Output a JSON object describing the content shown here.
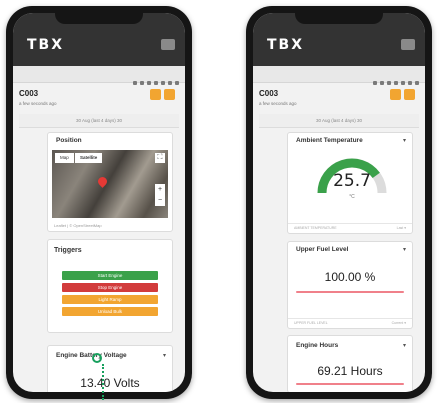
{
  "brand": {
    "logo": "TBX"
  },
  "left": {
    "device": {
      "title": "C003",
      "subtitle": "a few seconds ago"
    },
    "date_range": {
      "label": "30 Aug (last 4 days) 30"
    },
    "position": {
      "title": "Position",
      "map_tabs": [
        "Map",
        "Satellite"
      ],
      "caption": "Leaflet | © OpenStreetMap"
    },
    "triggers": {
      "title": "Triggers",
      "buttons": [
        {
          "label": "Start Engine",
          "color": "#3aa14a"
        },
        {
          "label": "Stop Engine",
          "color": "#d23b3b"
        },
        {
          "label": "Light Ramp",
          "color": "#f2a531"
        },
        {
          "label": "Unload Bulk",
          "color": "#f2a531"
        }
      ]
    },
    "battery": {
      "title": "Engine Battery Voltage",
      "value": "13.40 Volts"
    }
  },
  "right": {
    "device": {
      "title": "C003",
      "subtitle": "a few seconds ago"
    },
    "date_range": {
      "label": "30 Aug (last 4 days) 30"
    },
    "ambient": {
      "title": "Ambient Temperature",
      "value": "25.7",
      "unit": "°C",
      "fraction": 0.8,
      "footer_left": "AMBIENT TEMPERATURE",
      "footer_right": "Last ▾"
    },
    "fuel": {
      "title": "Upper Fuel Level",
      "value": "100.00 %",
      "footer_left": "UPPER FUEL LEVEL",
      "footer_right": "Current ▾"
    },
    "hours": {
      "title": "Engine Hours",
      "value": "69.21 Hours"
    }
  },
  "colors": {
    "accent": "#f2a531",
    "gauge": "#3aa14a",
    "cursor": "#18a05e"
  }
}
